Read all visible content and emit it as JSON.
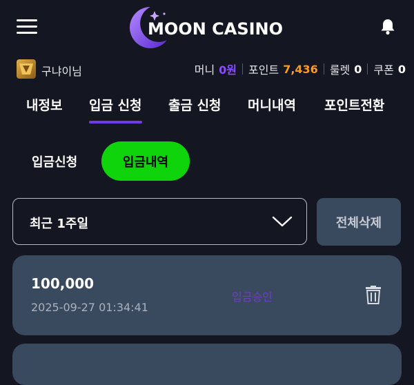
{
  "header": {
    "logo_text": "MOON CASINO",
    "menu_icon": "hamburger-menu-icon",
    "bell_icon": "bell-icon"
  },
  "user": {
    "name": "구냐이님",
    "money_label": "머니",
    "money_value": "0원",
    "point_label": "포인트",
    "point_value": "7,436",
    "roulette_label": "룰렛",
    "roulette_value": "0",
    "coupon_label": "쿠폰",
    "coupon_value": "0"
  },
  "tabs": [
    {
      "label": "내정보",
      "active": false
    },
    {
      "label": "입금 신청",
      "active": true
    },
    {
      "label": "출금 신청",
      "active": false
    },
    {
      "label": "머니내역",
      "active": false
    },
    {
      "label": "포인트전환",
      "active": false
    }
  ],
  "subtabs": {
    "apply": "입금신청",
    "history": "입금내역"
  },
  "filter": {
    "selected": "최근 1주일",
    "delete_all": "전체삭제"
  },
  "records": [
    {
      "amount": "100,000",
      "date": "2025-09-27 01:34:41",
      "status": "입금승인"
    }
  ],
  "colors": {
    "background": "#141622",
    "accent_purple": "#6e3bea",
    "active_green": "#0fd30b",
    "point_orange": "#ff9a1a",
    "card": "#3a4a5e"
  }
}
